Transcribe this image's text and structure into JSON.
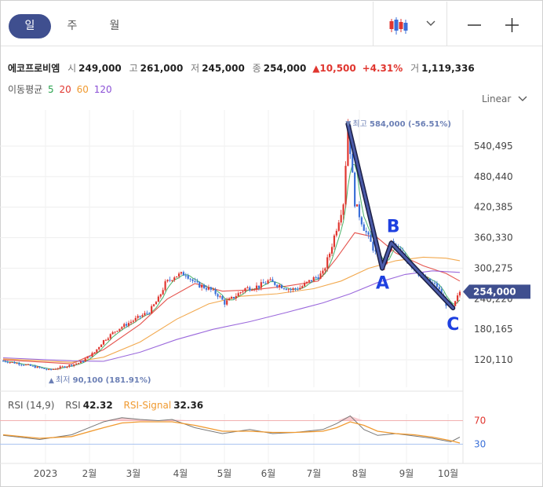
{
  "periods": [
    "일",
    "주",
    "월"
  ],
  "stock": {
    "name": "에코프로비엠",
    "open_label": "시",
    "open": "249,000",
    "high_label": "고",
    "high": "261,000",
    "low_label": "저",
    "low": "245,000",
    "close_label": "종",
    "close": "254,000",
    "change": "▲10,500",
    "change_pct": "+4.31%",
    "volume_label": "거",
    "volume": "1,119,336"
  },
  "moving_average": {
    "label": "이동평균",
    "periods": [
      "5",
      "20",
      "60",
      "120"
    ],
    "colors": [
      "#2aa44f",
      "#e0362f",
      "#f09a30",
      "#8a4fd6"
    ]
  },
  "scale_mode": "Linear",
  "icons": {
    "chart_type": "candlestick-icon",
    "dropdown": "chevron-down-icon",
    "zoom_out": "minus-icon",
    "zoom_in": "plus-icon"
  },
  "colors": {
    "up": "#e0362f",
    "down": "#3a6fd8",
    "accent": "#3f4f8f",
    "annotation": "#1e40e0"
  },
  "chart_data": {
    "type": "candlestick",
    "x_labels": [
      "2023",
      "2월",
      "3월",
      "4월",
      "5월",
      "6월",
      "7월",
      "8월",
      "9월",
      "10월"
    ],
    "y_ticks": [
      "540,495",
      "480,440",
      "420,385",
      "360,330",
      "300,275",
      "240,220",
      "180,165",
      "120,110"
    ],
    "ylim": [
      90000,
      600000
    ],
    "current_price": "254,000",
    "high_marker": {
      "label": "최고",
      "value": "584,000",
      "pct": "(-56.51%)"
    },
    "low_marker": {
      "label": "최저",
      "value": "90,100",
      "pct": "(181.91%)"
    },
    "annotations": [
      {
        "label": "A",
        "price": 300000
      },
      {
        "label": "B",
        "price": 350000
      },
      {
        "label": "C",
        "price": 222000
      }
    ],
    "pattern_path_prices": [
      584000,
      300000,
      350000,
      222000
    ],
    "price_path": [
      [
        0,
        118000
      ],
      [
        0.5,
        110000
      ],
      [
        1,
        100000
      ],
      [
        1.4,
        108000
      ],
      [
        1.7,
        115000
      ],
      [
        2.0,
        135000
      ],
      [
        2.2,
        158000
      ],
      [
        2.5,
        180000
      ],
      [
        2.8,
        195000
      ],
      [
        3.0,
        205000
      ],
      [
        3.2,
        215000
      ],
      [
        3.4,
        240000
      ],
      [
        3.55,
        270000
      ],
      [
        3.75,
        285000
      ],
      [
        4.0,
        290000
      ],
      [
        4.2,
        270000
      ],
      [
        4.5,
        260000
      ],
      [
        4.7,
        248000
      ],
      [
        4.85,
        232000
      ],
      [
        5.0,
        240000
      ],
      [
        5.3,
        260000
      ],
      [
        5.6,
        265000
      ],
      [
        5.8,
        275000
      ],
      [
        6.1,
        265000
      ],
      [
        6.3,
        258000
      ],
      [
        6.5,
        262000
      ],
      [
        6.8,
        280000
      ],
      [
        7.0,
        290000
      ],
      [
        7.15,
        330000
      ],
      [
        7.3,
        380000
      ],
      [
        7.45,
        430000
      ],
      [
        7.55,
        584000
      ],
      [
        7.7,
        430000
      ],
      [
        7.9,
        380000
      ],
      [
        8.1,
        340000
      ],
      [
        8.3,
        300000
      ],
      [
        8.5,
        350000
      ],
      [
        8.8,
        320000
      ],
      [
        9.2,
        280000
      ],
      [
        9.5,
        265000
      ],
      [
        9.7,
        230000
      ],
      [
        9.85,
        222000
      ],
      [
        10.0,
        254000
      ]
    ],
    "ma": [
      {
        "name": "20",
        "points": [
          [
            0,
            120000
          ],
          [
            1.5,
            112000
          ],
          [
            2.2,
            140000
          ],
          [
            3.0,
            190000
          ],
          [
            3.6,
            240000
          ],
          [
            4.2,
            270000
          ],
          [
            4.8,
            255000
          ],
          [
            5.5,
            258000
          ],
          [
            6.2,
            265000
          ],
          [
            6.9,
            275000
          ],
          [
            7.3,
            320000
          ],
          [
            7.7,
            370000
          ],
          [
            8.2,
            360000
          ],
          [
            8.6,
            330000
          ],
          [
            9.2,
            305000
          ],
          [
            9.7,
            290000
          ],
          [
            10,
            275000
          ]
        ]
      },
      {
        "name": "60",
        "points": [
          [
            0,
            122000
          ],
          [
            1.5,
            115000
          ],
          [
            2.2,
            125000
          ],
          [
            3.0,
            155000
          ],
          [
            3.8,
            200000
          ],
          [
            4.5,
            230000
          ],
          [
            5.2,
            245000
          ],
          [
            6.0,
            250000
          ],
          [
            6.8,
            260000
          ],
          [
            7.4,
            275000
          ],
          [
            8.0,
            300000
          ],
          [
            8.6,
            315000
          ],
          [
            9.2,
            322000
          ],
          [
            9.7,
            320000
          ],
          [
            10,
            315000
          ]
        ]
      },
      {
        "name": "120",
        "points": [
          [
            0,
            124000
          ],
          [
            1.5,
            118000
          ],
          [
            2.2,
            117000
          ],
          [
            3.0,
            135000
          ],
          [
            3.8,
            160000
          ],
          [
            4.6,
            180000
          ],
          [
            5.4,
            195000
          ],
          [
            6.2,
            213000
          ],
          [
            7.0,
            232000
          ],
          [
            7.6,
            250000
          ],
          [
            8.2,
            272000
          ],
          [
            8.8,
            288000
          ],
          [
            9.4,
            295000
          ],
          [
            10,
            292000
          ]
        ]
      }
    ],
    "rsi": {
      "label": "RSI (14,9)",
      "rsi_label": "RSI",
      "rsi_value": "42.32",
      "signal_label": "RSI-Signal",
      "signal_value": "32.36",
      "levels": [
        "70",
        "30"
      ],
      "rsi_path": [
        [
          0,
          45
        ],
        [
          0.8,
          38
        ],
        [
          1.5,
          46
        ],
        [
          2.2,
          68
        ],
        [
          2.6,
          75
        ],
        [
          3.0,
          72
        ],
        [
          3.4,
          70
        ],
        [
          3.7,
          72
        ],
        [
          4.2,
          58
        ],
        [
          4.8,
          48
        ],
        [
          5.4,
          55
        ],
        [
          5.9,
          48
        ],
        [
          6.4,
          50
        ],
        [
          7.0,
          55
        ],
        [
          7.3,
          65
        ],
        [
          7.6,
          78
        ],
        [
          7.9,
          55
        ],
        [
          8.2,
          45
        ],
        [
          8.6,
          48
        ],
        [
          9.0,
          44
        ],
        [
          9.4,
          40
        ],
        [
          9.8,
          34
        ],
        [
          10,
          42
        ]
      ],
      "signal_path": [
        [
          0,
          46
        ],
        [
          0.8,
          40
        ],
        [
          1.5,
          43
        ],
        [
          2.2,
          58
        ],
        [
          2.6,
          66
        ],
        [
          3.0,
          68
        ],
        [
          3.4,
          68
        ],
        [
          3.7,
          68
        ],
        [
          4.2,
          62
        ],
        [
          4.8,
          52
        ],
        [
          5.4,
          52
        ],
        [
          5.9,
          50
        ],
        [
          6.4,
          50
        ],
        [
          7.0,
          52
        ],
        [
          7.3,
          58
        ],
        [
          7.6,
          68
        ],
        [
          7.9,
          62
        ],
        [
          8.2,
          52
        ],
        [
          8.6,
          48
        ],
        [
          9.0,
          46
        ],
        [
          9.4,
          42
        ],
        [
          9.8,
          36
        ],
        [
          10,
          32
        ]
      ]
    }
  }
}
